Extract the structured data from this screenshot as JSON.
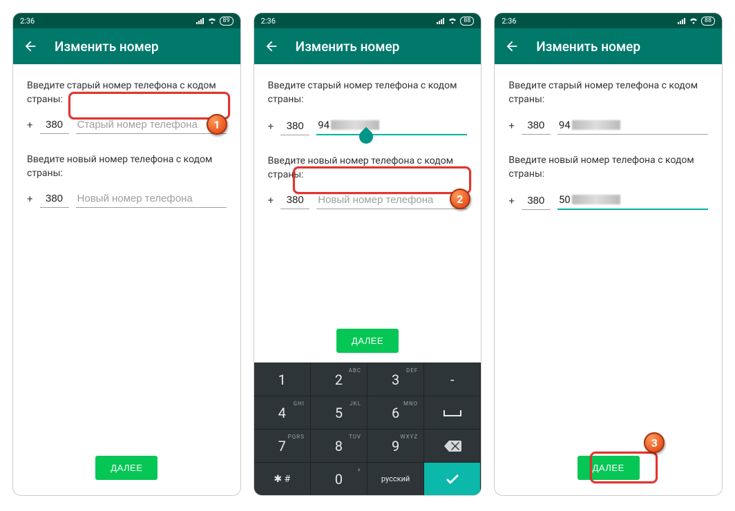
{
  "status": {
    "time": "2:36",
    "battery1": "89",
    "battery2": "88",
    "battery3": "88"
  },
  "appbar": {
    "title": "Изменить номер"
  },
  "labels": {
    "old_prompt": "Введите старый номер телефона с кодом страны:",
    "new_prompt": "Введите новый номер телефона с кодом страны:",
    "plus": "+",
    "cc": "380",
    "old_placeholder": "Старый номер телефона",
    "new_placeholder": "Новый номер телефона",
    "next": "ДАЛЕЕ"
  },
  "screen2": {
    "old_prefix": "94"
  },
  "screen3": {
    "old_prefix": "94",
    "new_prefix": "50"
  },
  "badges": {
    "b1": "1",
    "b2": "2",
    "b3": "3"
  },
  "keyboard": {
    "r1": [
      {
        "n": "1",
        "s": ""
      },
      {
        "n": "2",
        "s": "ABC"
      },
      {
        "n": "3",
        "s": "DEF"
      },
      {
        "n": "-",
        "s": ""
      }
    ],
    "r2": [
      {
        "n": "4",
        "s": "GHI"
      },
      {
        "n": "5",
        "s": "JKL"
      },
      {
        "n": "6",
        "s": "MNO"
      },
      {
        "n": "␣",
        "s": ""
      }
    ],
    "r3": [
      {
        "n": "7",
        "s": "PQRS"
      },
      {
        "n": "8",
        "s": "TUV"
      },
      {
        "n": "9",
        "s": "WXYZ"
      },
      {
        "n": "⌫",
        "s": ""
      }
    ],
    "r4": [
      {
        "n": "✱ #",
        "s": ""
      },
      {
        "n": "0",
        "s": "+"
      },
      {
        "n": "русский",
        "s": ""
      },
      {
        "n": "✓",
        "s": ""
      }
    ]
  }
}
